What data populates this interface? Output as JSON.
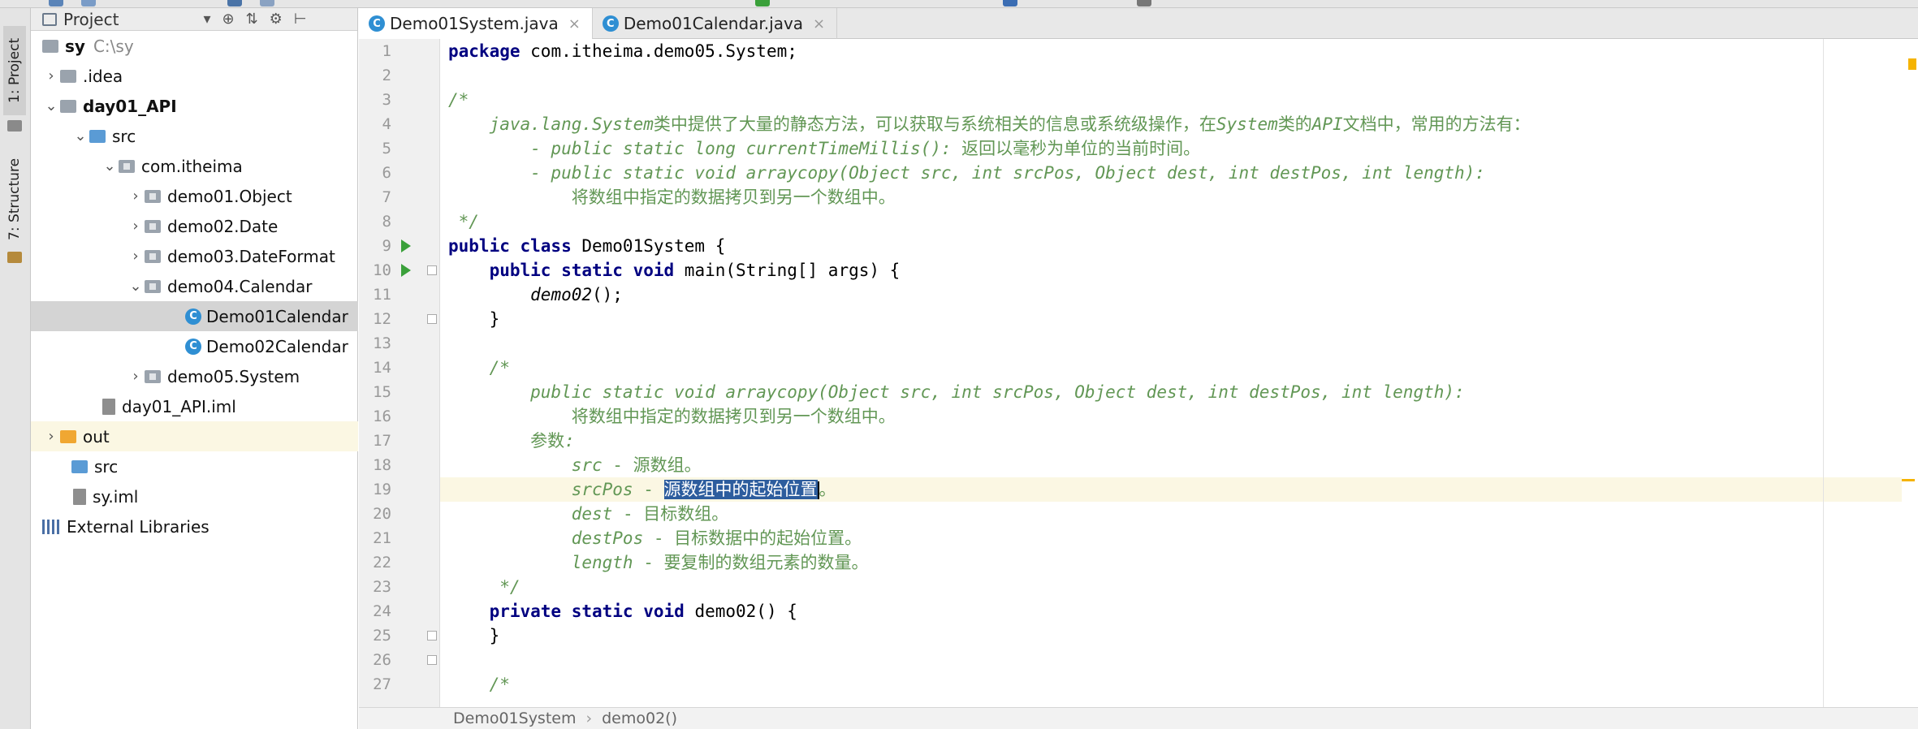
{
  "project_panel": {
    "title": "Project",
    "tree": [
      {
        "label": "sy",
        "path": "C:\\sy"
      },
      {
        "label": ".idea"
      },
      {
        "label": "day01_API"
      },
      {
        "label": "src"
      },
      {
        "label": "com.itheima"
      },
      {
        "label": "demo01.Object"
      },
      {
        "label": "demo02.Date"
      },
      {
        "label": "demo03.DateFormat"
      },
      {
        "label": "demo04.Calendar"
      },
      {
        "label": "Demo01Calendar"
      },
      {
        "label": "Demo02Calendar"
      },
      {
        "label": "demo05.System"
      },
      {
        "label": "day01_API.iml"
      },
      {
        "label": "out"
      },
      {
        "label": "src"
      },
      {
        "label": "sy.iml"
      },
      {
        "label": "External Libraries"
      }
    ]
  },
  "side_strip": {
    "tab1": "1: Project",
    "tab2": "7: Structure"
  },
  "editor": {
    "tabs": [
      {
        "label": "Demo01System.java",
        "active": true
      },
      {
        "label": "Demo01Calendar.java",
        "active": false
      }
    ],
    "line_numbers": [
      "1",
      "2",
      "3",
      "4",
      "5",
      "6",
      "7",
      "8",
      "9",
      "10",
      "11",
      "12",
      "13",
      "14",
      "15",
      "16",
      "17",
      "18",
      "19",
      "20",
      "21",
      "22",
      "23",
      "24",
      "25",
      "26",
      "27"
    ],
    "code": {
      "l1_kw": "package",
      "l1_rest": " com.itheima.demo05.System;",
      "l3": "/*",
      "l4_a": "    java.lang.System",
      "l4_b": "类中提供了大量的静态方法，可以获取与系统相关的信息或系统级操作，在",
      "l4_c": "System",
      "l4_d": "类的",
      "l4_e": "API",
      "l4_f": "文档中，常用的方法有：",
      "l5_a": "        - public static long currentTimeMillis():",
      "l5_b": " 返回以毫秒为单位的当前时间。",
      "l6": "        - public static void arraycopy(Object src, int srcPos, Object dest, int destPos, int length):",
      "l7": "            将数组中指定的数据拷贝到另一个数组中。",
      "l8": " */",
      "l9_kw": "public class",
      "l9_rest": " Demo01System {",
      "l10_kw": "    public static void",
      "l10_rest": " main(String[] args) {",
      "l11_a": "        ",
      "l11_b": "demo02",
      "l11_c": "();",
      "l12": "    }",
      "l14": "    /*",
      "l15": "        public static void arraycopy(Object src, int srcPos, Object dest, int destPos, int length):",
      "l16": "            将数组中指定的数据拷贝到另一个数组中。",
      "l17_a": "        参数",
      "l17_b": ":",
      "l18_a": "            src",
      "l18_b": " - 源数组。",
      "l19_a": "            srcPos",
      "l19_b": " - ",
      "l19_sel": "源数组中的起始位置",
      "l19_c": "。",
      "l20_a": "            dest",
      "l20_b": " - 目标数组。",
      "l21_a": "            destPos",
      "l21_b": " - 目标数据中的起始位置。",
      "l22_a": "            length",
      "l22_b": " - 要复制的数组元素的数量。",
      "l23": "     */",
      "l24_kw": "    private static void",
      "l24_rest": " demo02() {",
      "l25": "    }",
      "l27": "    /*"
    }
  },
  "breadcrumb": {
    "items": [
      "Demo01System",
      "demo02()"
    ]
  },
  "colors": {
    "keyword": "#000080",
    "comment": "#629755",
    "selection": "#2d5d9e",
    "current_line": "#fbf7e3"
  }
}
